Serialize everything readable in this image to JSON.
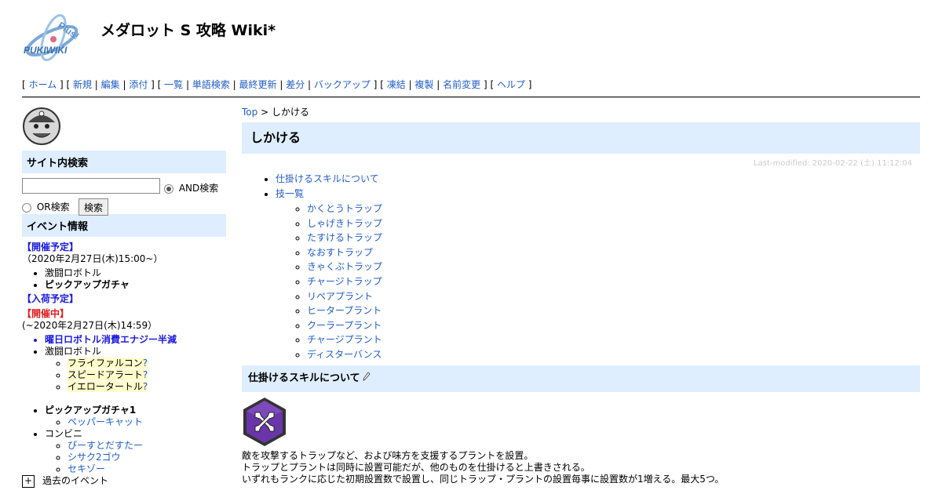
{
  "header": {
    "logo_text": "PUKIWIKI",
    "logo_plus": "Plus!",
    "title": "メダロット S 攻略 Wiki*"
  },
  "navigator": {
    "groups": [
      [
        "ホーム"
      ],
      [
        "新規",
        "編集",
        "添付"
      ],
      [
        "一覧",
        "単語検索",
        "最終更新",
        "差分",
        "バックアップ"
      ],
      [
        "凍結",
        "複製",
        "名前変更"
      ],
      [
        "ヘルプ"
      ]
    ]
  },
  "menubar": {
    "search_heading": "サイト内検索",
    "search_value": "",
    "and_label": "AND検索",
    "or_label": "OR検索",
    "search_button": "検索",
    "events_heading": "イベント情報",
    "scheduled_heading": "【開催予定】",
    "scheduled_date": "（2020年2月27日(木)15:00~）",
    "scheduled_items": [
      "激闘ロボトル",
      "ピックアップガチャ"
    ],
    "arrival_heading": "【入荷予定】",
    "ongoing_heading": "【開催中】",
    "ongoing_date": "(~2020年2月27日(木)14:59）",
    "ongoing_item1": "曜日ロボトル消費エナジー半減",
    "ongoing_item2": "激闘ロボトル",
    "ongoing_sub": [
      "フライファルコン",
      "スピードアラート",
      "イエロータートル"
    ],
    "qmark": "?",
    "gacha_item": "ピックアップガチャ1",
    "gacha_sub": [
      "ペッパーキャット"
    ],
    "conv_item": "コンビニ",
    "conv_sub": [
      "ぴーすとだすたー",
      "シサク2ゴウ",
      "セキゾー"
    ],
    "past_toggle": "+",
    "past_label": "過去のイベント"
  },
  "main": {
    "topicpath_link": "Top",
    "topicpath_sep": " > ",
    "topicpath_current": "しかける",
    "title": "しかける",
    "lastmod": "Last-modified: 2020-02-22 (土) 11:12:04",
    "toc_item1": "仕掛けるスキルについて",
    "toc_item2": "技一覧",
    "toc_sub": [
      "かくとうトラップ",
      "しゃげきトラップ",
      "たすけるトラップ",
      "なおすトラップ",
      "きゃくぶトラップ",
      "チャージトラップ",
      "リペアプラント",
      "ヒータープラント",
      "クーラープラント",
      "チャージプラント",
      "ディスターバンス"
    ],
    "section_heading": "仕掛けるスキルについて",
    "desc": [
      "敵を攻撃するトラップなど、および味方を支援するプラントを設置。",
      "トラップとプラントは同時に設置可能だが、他のものを仕掛けると上書きされる。",
      "いずれもランクに応じた初期設置数で設置し、同じトラップ・プラントの設置毎事に設置数が1増える。最大5つ。"
    ]
  },
  "colors": {
    "link": "#215dc6",
    "heading_bg": "#deeefe",
    "event_blue": "#1a1ae0",
    "event_red": "#e01a1a",
    "highlight": "#ffffcc",
    "skill_icon": "#5a2a8a"
  }
}
